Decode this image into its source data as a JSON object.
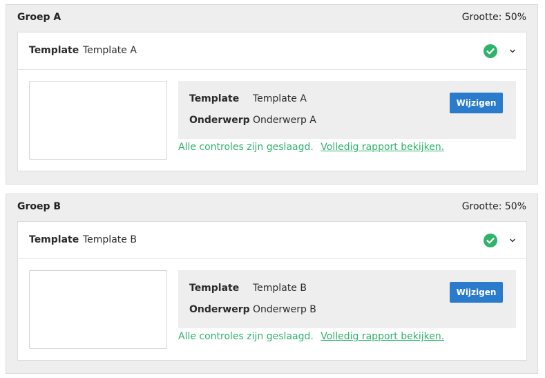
{
  "groups": [
    {
      "title": "Groep A",
      "size": "Grootte: 50%",
      "header_label": "Template",
      "header_value": "Template A",
      "details": {
        "template_label": "Template",
        "template_value": "Template A",
        "subject_label": "Onderwerp",
        "subject_value": "Onderwerp A",
        "edit_button": "Wijzigen"
      },
      "status_text": "Alle controles zijn geslaagd.",
      "report_link": "Volledig rapport bekijken."
    },
    {
      "title": "Groep B",
      "size": "Grootte: 50%",
      "header_label": "Template",
      "header_value": "Template B",
      "details": {
        "template_label": "Template",
        "template_value": "Template B",
        "subject_label": "Onderwerp",
        "subject_value": "Onderwerp B",
        "edit_button": "Wijzigen"
      },
      "status_text": "Alle controles zijn geslaagd.",
      "report_link": "Volledig rapport bekijken."
    }
  ],
  "icons": {
    "status": "check-circle-icon",
    "expand": "chevron-down-icon"
  },
  "colors": {
    "success": "#2fb26a",
    "primary_button": "#2a7bcb",
    "group_background": "#eeeeee"
  }
}
